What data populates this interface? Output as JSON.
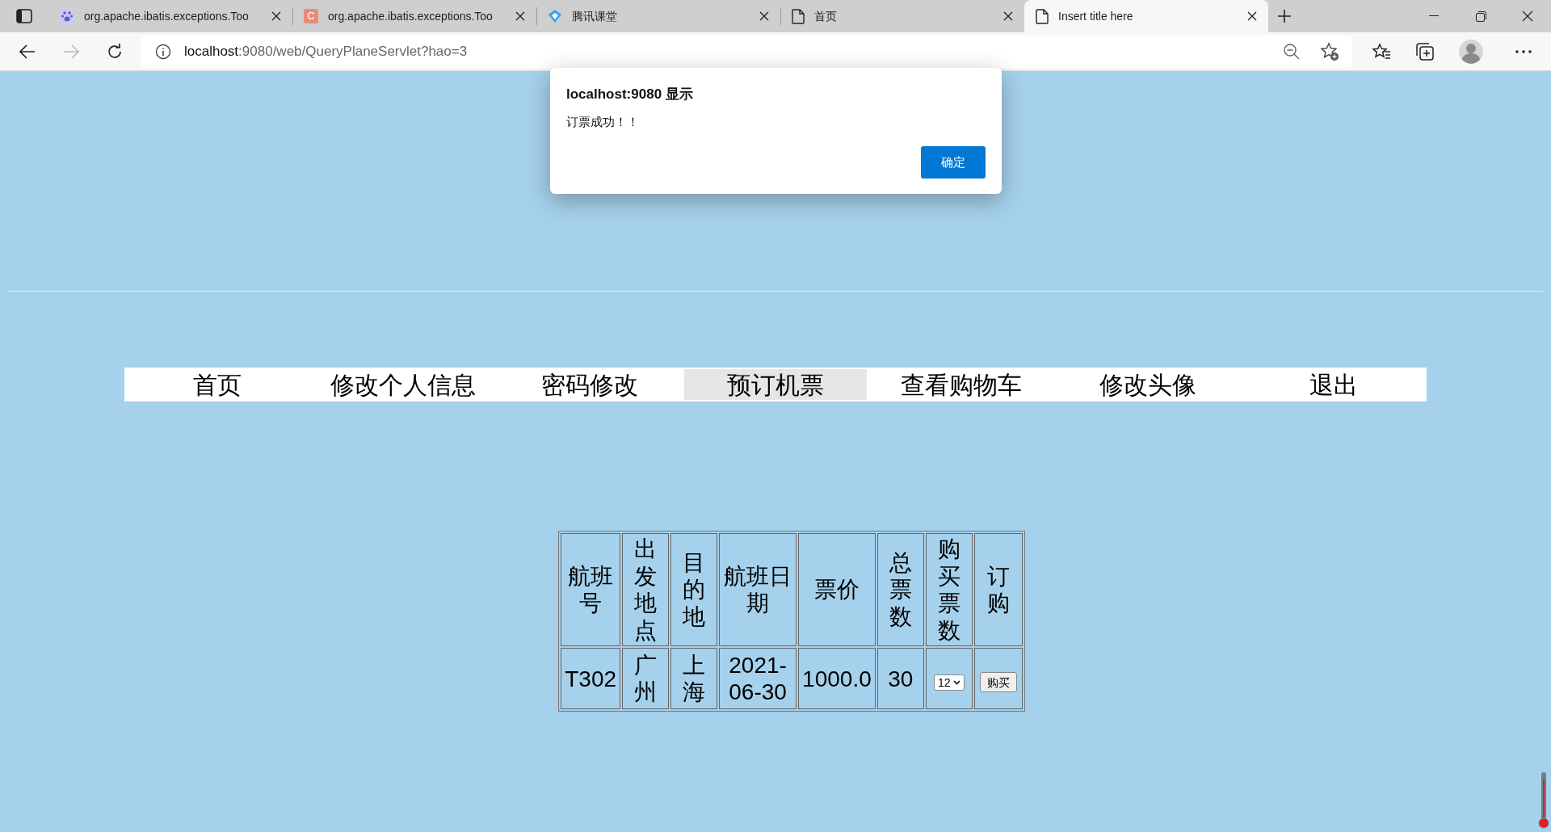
{
  "browser": {
    "tabs": [
      {
        "title": "org.apache.ibatis.exceptions.Too",
        "kind": "paw",
        "selected": false
      },
      {
        "title": "org.apache.ibatis.exceptions.Too",
        "kind": "letter",
        "letter": "C",
        "selected": false
      },
      {
        "title": "腾讯课堂",
        "kind": "diamond",
        "selected": false
      },
      {
        "title": "首页",
        "kind": "page",
        "selected": false
      },
      {
        "title": "Insert title here",
        "kind": "page",
        "selected": true
      }
    ],
    "address": {
      "host": "localhost",
      "path": ":9080/web/QueryPlaneServlet?hao=3"
    }
  },
  "nav": {
    "items": [
      {
        "label": "首页",
        "selected": false
      },
      {
        "label": "修改个人信息",
        "selected": false
      },
      {
        "label": "密码修改",
        "selected": false
      },
      {
        "label": "预订机票",
        "selected": true
      },
      {
        "label": "查看购物车",
        "selected": false
      },
      {
        "label": "修改头像",
        "selected": false
      },
      {
        "label": "退出",
        "selected": false
      }
    ]
  },
  "table": {
    "columns": [
      "航班号",
      "出发地点",
      "目的地",
      "航班日期",
      "票价",
      "总票数",
      "购买票数",
      "订购"
    ],
    "rows": [
      {
        "cells": [
          "T302",
          "广州",
          "上海",
          "2021-06-30",
          "1000.0",
          "30"
        ],
        "quantity": "12",
        "button": "购买"
      }
    ]
  },
  "dialog": {
    "title": "localhost:9080 显示",
    "message": "订票成功！！",
    "button": "确定"
  }
}
